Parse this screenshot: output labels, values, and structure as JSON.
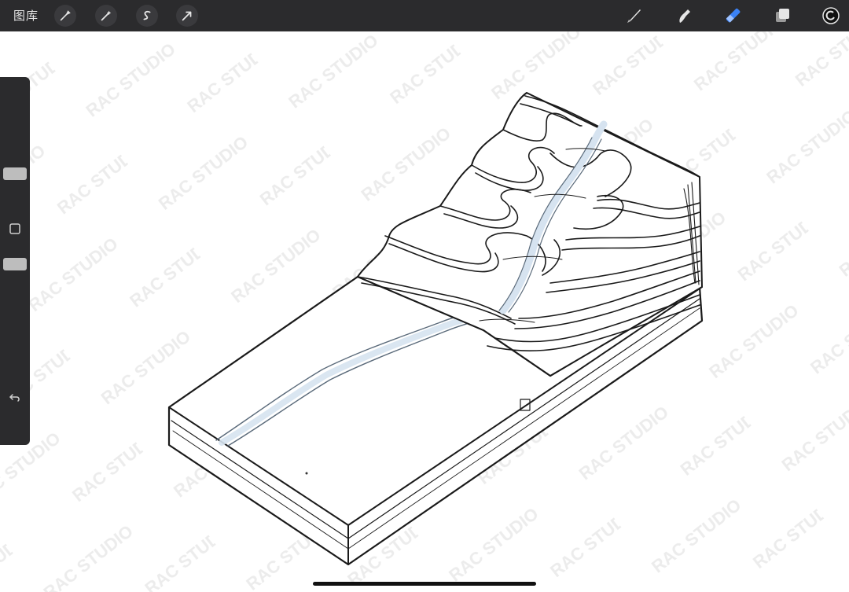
{
  "topbar": {
    "gallery_label": "图库",
    "left_tools": [
      {
        "name": "wrench-icon"
      },
      {
        "name": "adjustments-wand-icon"
      },
      {
        "name": "selection-s-icon"
      },
      {
        "name": "transform-arrow-icon"
      }
    ],
    "right_tools": [
      {
        "name": "brush-icon"
      },
      {
        "name": "smudge-icon"
      },
      {
        "name": "eraser-icon",
        "active": true
      },
      {
        "name": "layers-icon"
      },
      {
        "name": "color-picker-icon"
      }
    ],
    "accent_color": "#3b82f6"
  },
  "sidebar": {
    "brush_size_level": 0.28,
    "opacity_level": 0.5,
    "modify_button_icon": "square-icon",
    "undo_icon": "undo-icon"
  },
  "canvas": {
    "watermark_text": "RAC STUDIO",
    "drawing": "terrain-block-sketch"
  }
}
